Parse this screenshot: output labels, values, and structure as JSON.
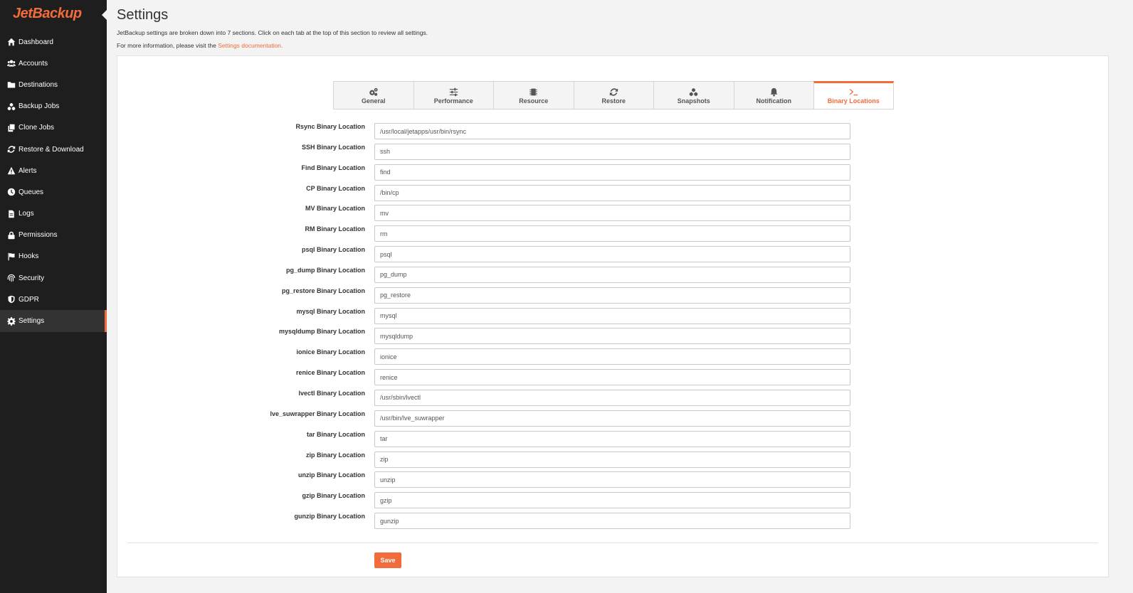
{
  "brand": {
    "name": "JetBackup",
    "accent": "#f26b3a"
  },
  "sidebar": {
    "items": [
      {
        "label": "Dashboard",
        "icon": "home-icon"
      },
      {
        "label": "Accounts",
        "icon": "users-icon"
      },
      {
        "label": "Destinations",
        "icon": "folder-icon"
      },
      {
        "label": "Backup Jobs",
        "icon": "cubes-icon"
      },
      {
        "label": "Clone Jobs",
        "icon": "copy-icon"
      },
      {
        "label": "Restore & Download",
        "icon": "sync-icon"
      },
      {
        "label": "Alerts",
        "icon": "warning-icon"
      },
      {
        "label": "Queues",
        "icon": "clock-icon"
      },
      {
        "label": "Logs",
        "icon": "file-icon"
      },
      {
        "label": "Permissions",
        "icon": "lock-icon"
      },
      {
        "label": "Hooks",
        "icon": "flag-icon"
      },
      {
        "label": "Security",
        "icon": "fingerprint-icon"
      },
      {
        "label": "GDPR",
        "icon": "shield-icon"
      },
      {
        "label": "Settings",
        "icon": "gear-icon",
        "active": true
      }
    ]
  },
  "header": {
    "title": "Settings",
    "description": "JetBackup settings are broken down into 7 sections. Click on each tab at the top of this section to review all settings.",
    "more_info_prefix": "For more information, please visit the ",
    "more_info_link": "Settings documentation."
  },
  "tabs": [
    {
      "label": "General",
      "icon": "cogs-icon"
    },
    {
      "label": "Performance",
      "icon": "sliders-icon"
    },
    {
      "label": "Resource",
      "icon": "chip-icon"
    },
    {
      "label": "Restore",
      "icon": "sync-icon"
    },
    {
      "label": "Snapshots",
      "icon": "cubes-icon"
    },
    {
      "label": "Notification",
      "icon": "bell-icon"
    },
    {
      "label": "Binary Locations",
      "icon": "terminal-icon",
      "active": true
    }
  ],
  "fields": [
    {
      "label": "Rsync Binary Location",
      "value": "/usr/local/jetapps/usr/bin/rsync"
    },
    {
      "label": "SSH Binary Location",
      "value": "ssh"
    },
    {
      "label": "Find Binary Location",
      "value": "find"
    },
    {
      "label": "CP Binary Location",
      "value": "/bin/cp"
    },
    {
      "label": "MV Binary Location",
      "value": "mv"
    },
    {
      "label": "RM Binary Location",
      "value": "rm"
    },
    {
      "label": "psql Binary Location",
      "value": "psql"
    },
    {
      "label": "pg_dump Binary Location",
      "value": "pg_dump"
    },
    {
      "label": "pg_restore Binary Location",
      "value": "pg_restore"
    },
    {
      "label": "mysql Binary Location",
      "value": "mysql"
    },
    {
      "label": "mysqldump Binary Location",
      "value": "mysqldump"
    },
    {
      "label": "ionice Binary Location",
      "value": "ionice"
    },
    {
      "label": "renice Binary Location",
      "value": "renice"
    },
    {
      "label": "lvectl Binary Location",
      "value": "/usr/sbin/lvectl"
    },
    {
      "label": "lve_suwrapper Binary Location",
      "value": "/usr/bin/lve_suwrapper"
    },
    {
      "label": "tar Binary Location",
      "value": "tar"
    },
    {
      "label": "zip Binary Location",
      "value": "zip"
    },
    {
      "label": "unzip Binary Location",
      "value": "unzip"
    },
    {
      "label": "gzip Binary Location",
      "value": "gzip"
    },
    {
      "label": "gunzip Binary Location",
      "value": "gunzip"
    }
  ],
  "actions": {
    "save_label": "Save"
  }
}
